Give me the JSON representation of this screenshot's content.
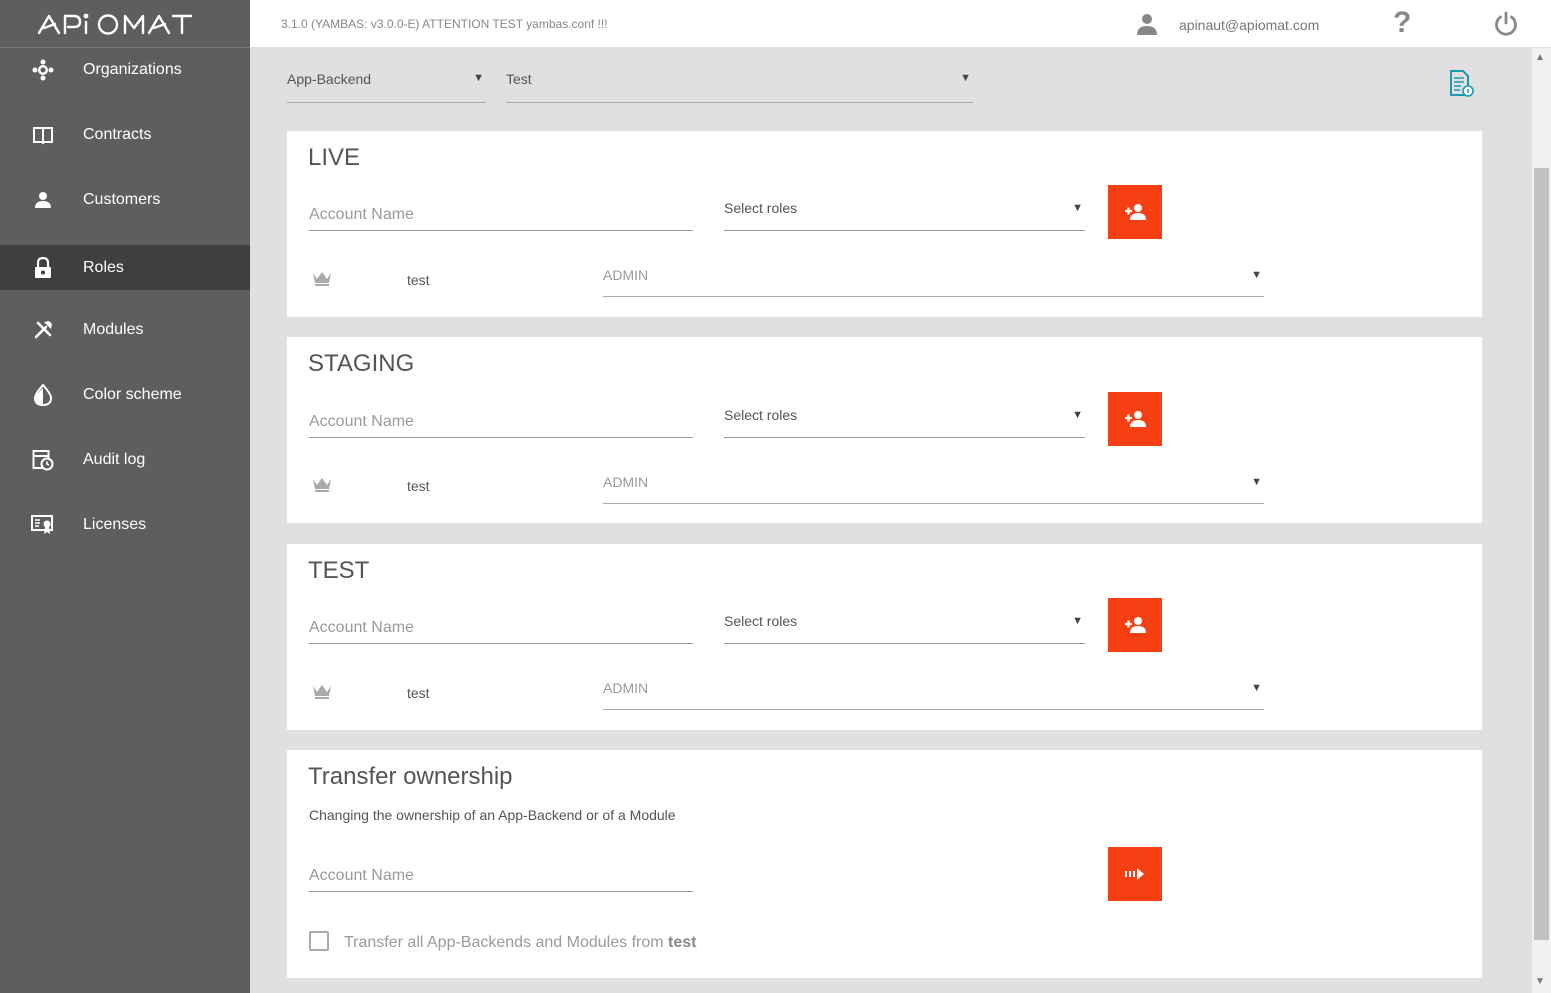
{
  "app": {
    "logo_text": "APIOMAT",
    "version": "3.1.0 (YAMBAS: v3.0.0-E) ATTENTION TEST yambas.conf !!!"
  },
  "user": {
    "email": "apinaut@apiomat.com"
  },
  "colors": {
    "accent": "#f73f14",
    "sidebar": "#5e5e5e",
    "sidebar_active": "#3f3f3f",
    "doc_icon": "#1a9ab0"
  },
  "sidebar": {
    "items": [
      {
        "label": "Organizations",
        "icon": "organizations-icon"
      },
      {
        "label": "Contracts",
        "icon": "book-icon"
      },
      {
        "label": "Customers",
        "icon": "person-icon"
      },
      {
        "label": "Roles",
        "icon": "lock-icon",
        "active": true
      },
      {
        "label": "Modules",
        "icon": "tools-icon"
      },
      {
        "label": "Color scheme",
        "icon": "drop-icon"
      },
      {
        "label": "Audit log",
        "icon": "audit-icon"
      },
      {
        "label": "Licenses",
        "icon": "license-icon"
      }
    ]
  },
  "selectors": {
    "backend": "App-Backend",
    "version": "Test"
  },
  "sections": [
    {
      "title": "LIVE",
      "account_placeholder": "Account Name",
      "roles_placeholder": "Select roles",
      "member": "test",
      "member_role": "ADMIN"
    },
    {
      "title": "STAGING",
      "account_placeholder": "Account Name",
      "roles_placeholder": "Select roles",
      "member": "test",
      "member_role": "ADMIN"
    },
    {
      "title": "TEST",
      "account_placeholder": "Account Name",
      "roles_placeholder": "Select roles",
      "member": "test",
      "member_role": "ADMIN"
    }
  ],
  "transfer": {
    "title": "Transfer ownership",
    "description": "Changing the ownership of an App-Backend or of a Module",
    "account_placeholder": "Account Name",
    "checkbox_label": "Transfer all App-Backends and Modules from",
    "checkbox_user": "test"
  }
}
